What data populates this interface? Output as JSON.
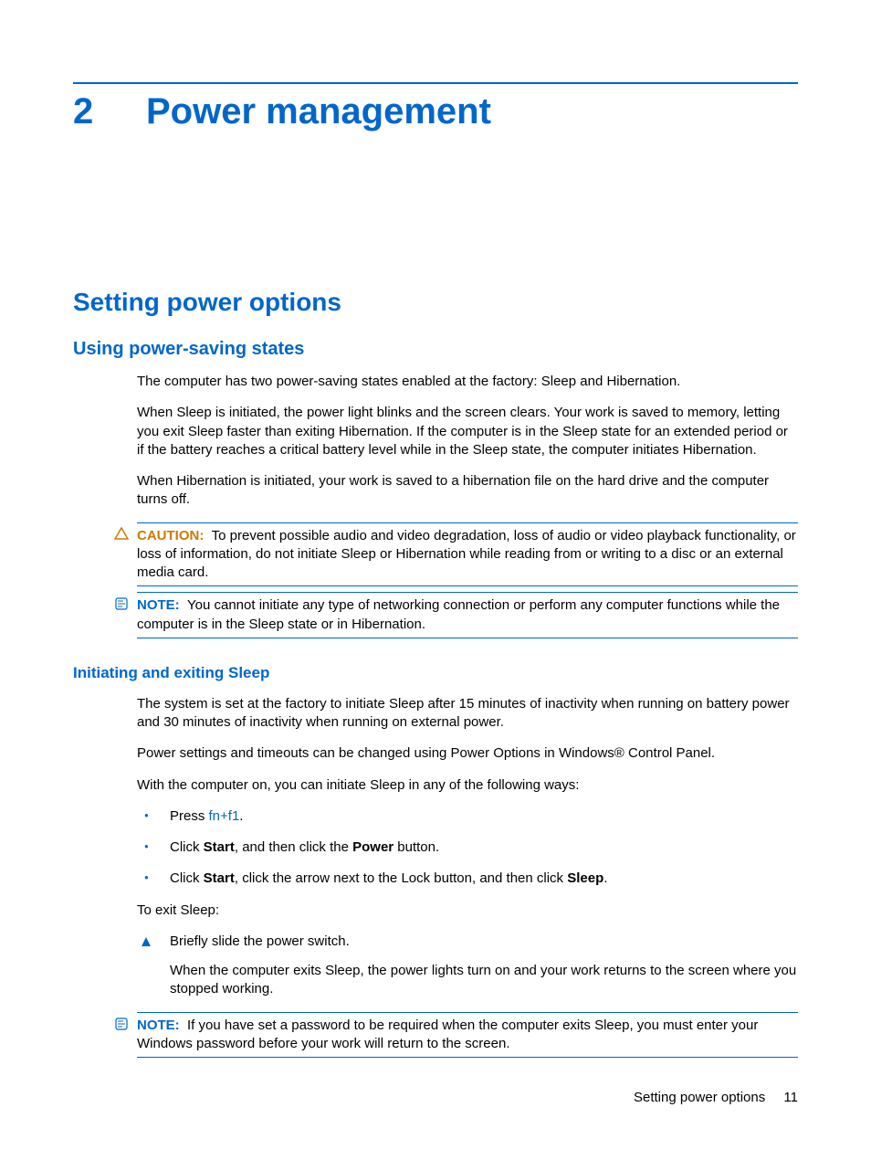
{
  "chapter": {
    "number": "2",
    "title": "Power management"
  },
  "section": {
    "title": "Setting power options"
  },
  "sub1": {
    "title": "Using power-saving states",
    "p1": "The computer has two power-saving states enabled at the factory: Sleep and Hibernation.",
    "p2": "When Sleep is initiated, the power light blinks and the screen clears. Your work is saved to memory, letting you exit Sleep faster than exiting Hibernation. If the computer is in the Sleep state for an extended period or if the battery reaches a critical battery level while in the Sleep state, the computer initiates Hibernation.",
    "p3": "When Hibernation is initiated, your work is saved to a hibernation file on the hard drive and the computer turns off.",
    "caution": {
      "label": "CAUTION:",
      "text": "To prevent possible audio and video degradation, loss of audio or video playback functionality, or loss of information, do not initiate Sleep or Hibernation while reading from or writing to a disc or an external media card."
    },
    "note1": {
      "label": "NOTE:",
      "text": "You cannot initiate any type of networking connection or perform any computer functions while the computer is in the Sleep state or in Hibernation."
    }
  },
  "sub2": {
    "title": "Initiating and exiting Sleep",
    "p1": "The system is set at the factory to initiate Sleep after 15 minutes of inactivity when running on battery power and 30 minutes of inactivity when running on external power.",
    "p2": "Power settings and timeouts can be changed using Power Options in Windows® Control Panel.",
    "p3": "With the computer on, you can initiate Sleep in any of the following ways:",
    "bullets": {
      "b1_pre": "Press ",
      "b1_link": "fn+f1",
      "b1_post": ".",
      "b2_pre": "Click ",
      "b2_b1": "Start",
      "b2_mid": ", and then click the ",
      "b2_b2": "Power",
      "b2_post": " button.",
      "b3_pre": "Click ",
      "b3_b1": "Start",
      "b3_mid": ", click the arrow next to the Lock button, and then click ",
      "b3_b2": "Sleep",
      "b3_post": "."
    },
    "p4": "To exit Sleep:",
    "step1": "Briefly slide the power switch.",
    "step1_sub": "When the computer exits Sleep, the power lights turn on and your work returns to the screen where you stopped working.",
    "note2": {
      "label": "NOTE:",
      "text": "If you have set a password to be required when the computer exits Sleep, you must enter your Windows password before your work will return to the screen."
    }
  },
  "footer": {
    "text": "Setting power options",
    "page": "11"
  }
}
